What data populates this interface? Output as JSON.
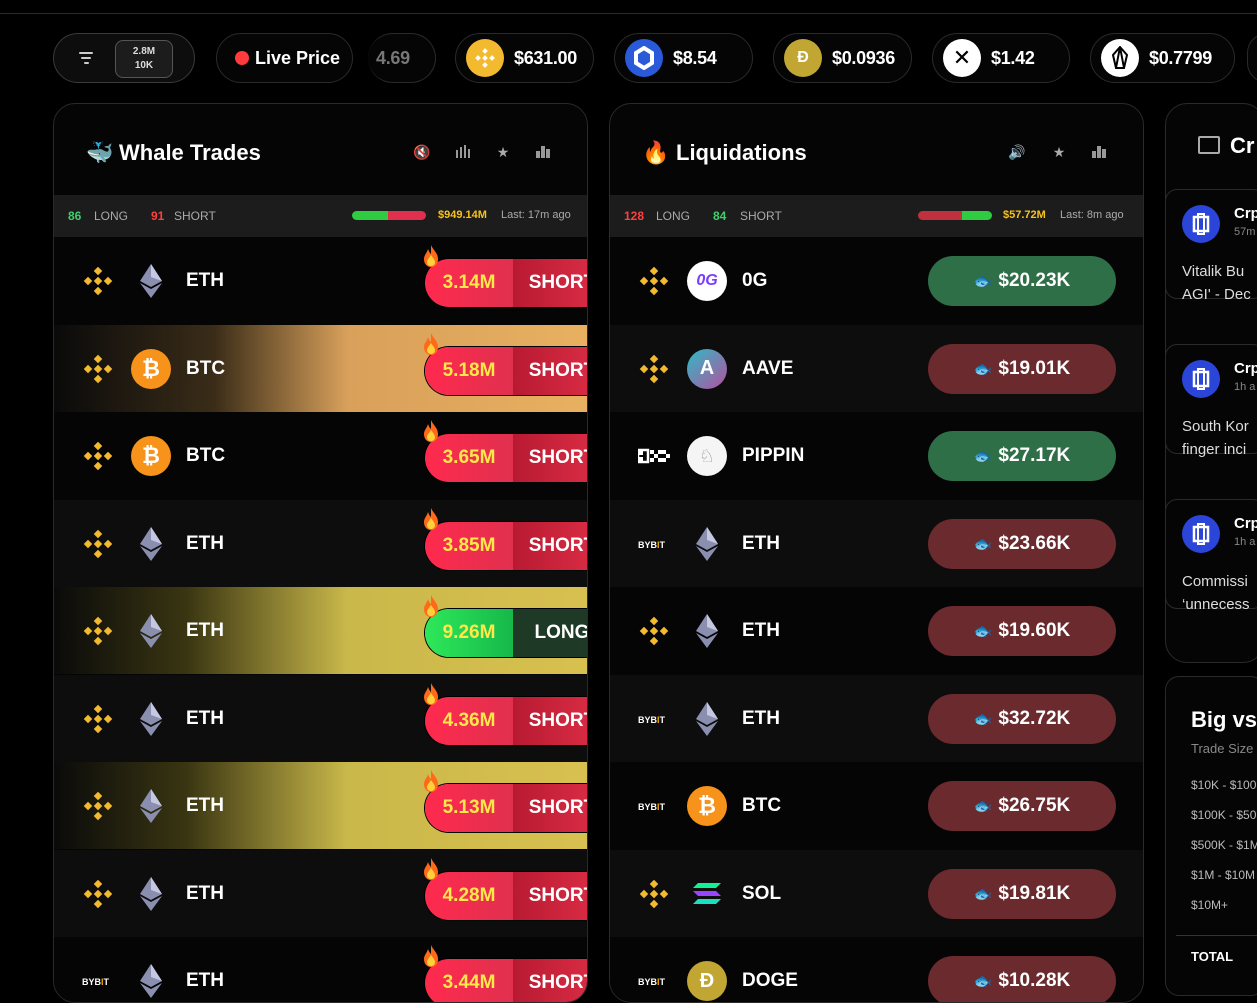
{
  "ticker": {
    "filter_top": "2.8M",
    "filter_bottom": "10K",
    "live_label": "Live Price",
    "partial_price": "4.69",
    "coins": [
      {
        "icon": "bnb-icon",
        "price": "$631.00",
        "color": "#f3ba2f"
      },
      {
        "icon": "chainlink-icon",
        "price": "$8.54",
        "color": "#2a5ada"
      },
      {
        "icon": "dogecoin-icon",
        "price": "$0.0936",
        "color": "#c2a633"
      },
      {
        "icon": "xrp-icon",
        "price": "$1.42",
        "color": "#ffffff"
      },
      {
        "icon": "eos-icon",
        "price": "$0.7799",
        "color": "#ffffff"
      }
    ]
  },
  "whale": {
    "title": "Whale Trades",
    "long_count": "86",
    "long_label": "LONG",
    "short_count": "91",
    "short_label": "SHORT",
    "total": "$949.14M",
    "last": "Last: 17m ago",
    "long_ratio": 0.49,
    "rows": [
      {
        "exchange": "binance",
        "coin": "eth",
        "symbol": "ETH",
        "amount": "3.14M",
        "side": "SHORT",
        "bg": "none"
      },
      {
        "exchange": "binance",
        "coin": "btc",
        "symbol": "BTC",
        "amount": "5.18M",
        "side": "SHORT",
        "bg": "doge"
      },
      {
        "exchange": "binance",
        "coin": "btc",
        "symbol": "BTC",
        "amount": "3.65M",
        "side": "SHORT",
        "bg": "none"
      },
      {
        "exchange": "binance",
        "coin": "eth",
        "symbol": "ETH",
        "amount": "3.85M",
        "side": "SHORT",
        "bg": "none"
      },
      {
        "exchange": "binance",
        "coin": "eth",
        "symbol": "ETH",
        "amount": "9.26M",
        "side": "LONG",
        "bg": "fine"
      },
      {
        "exchange": "binance",
        "coin": "eth",
        "symbol": "ETH",
        "amount": "4.36M",
        "side": "SHORT",
        "bg": "none"
      },
      {
        "exchange": "binance",
        "coin": "eth",
        "symbol": "ETH",
        "amount": "5.13M",
        "side": "SHORT",
        "bg": "fine"
      },
      {
        "exchange": "binance",
        "coin": "eth",
        "symbol": "ETH",
        "amount": "4.28M",
        "side": "SHORT",
        "bg": "none"
      },
      {
        "exchange": "bybit",
        "coin": "eth",
        "symbol": "ETH",
        "amount": "3.44M",
        "side": "SHORT",
        "bg": "none"
      }
    ]
  },
  "liq": {
    "title": "Liquidations",
    "short_count": "128",
    "long_label": "LONG",
    "long_count": "84",
    "short_label": "SHORT",
    "total": "$57.72M",
    "last": "Last: 8m ago",
    "long_ratio": 0.6,
    "rows": [
      {
        "exchange": "binance",
        "coin": "0g",
        "symbol": "0G",
        "amount": "$20.23K",
        "kind": "green"
      },
      {
        "exchange": "binance",
        "coin": "aave",
        "symbol": "AAVE",
        "amount": "$19.01K",
        "kind": "red"
      },
      {
        "exchange": "okx",
        "coin": "pippin",
        "symbol": "PIPPIN",
        "amount": "$27.17K",
        "kind": "green"
      },
      {
        "exchange": "bybit",
        "coin": "eth",
        "symbol": "ETH",
        "amount": "$23.66K",
        "kind": "red"
      },
      {
        "exchange": "binance",
        "coin": "eth",
        "symbol": "ETH",
        "amount": "$19.60K",
        "kind": "red"
      },
      {
        "exchange": "bybit",
        "coin": "eth",
        "symbol": "ETH",
        "amount": "$32.72K",
        "kind": "red"
      },
      {
        "exchange": "bybit",
        "coin": "btc",
        "symbol": "BTC",
        "amount": "$26.75K",
        "kind": "red"
      },
      {
        "exchange": "binance",
        "coin": "sol",
        "symbol": "SOL",
        "amount": "$19.81K",
        "kind": "red"
      },
      {
        "exchange": "bybit",
        "coin": "doge",
        "symbol": "DOGE",
        "amount": "$10.28K",
        "kind": "red"
      }
    ]
  },
  "news": {
    "title": "Cr",
    "items": [
      {
        "source": "Crp",
        "time": "57m",
        "line1": "Vitalik Bu",
        "line2": "AGI' - Dec"
      },
      {
        "source": "Crp",
        "time": "1h a",
        "line1": "South Kor",
        "line2": "finger inci"
      },
      {
        "source": "Crp",
        "time": "1h a",
        "line1": "Commissi",
        "line2": "‘unnecess"
      }
    ]
  },
  "bigvs": {
    "title": "Big vs",
    "subtitle": "Trade Size",
    "rows": [
      "$10K - $100",
      "$100K - $50",
      "$500K - $1M",
      "$1M - $10M",
      "$10M+"
    ],
    "total_label": "TOTAL"
  }
}
